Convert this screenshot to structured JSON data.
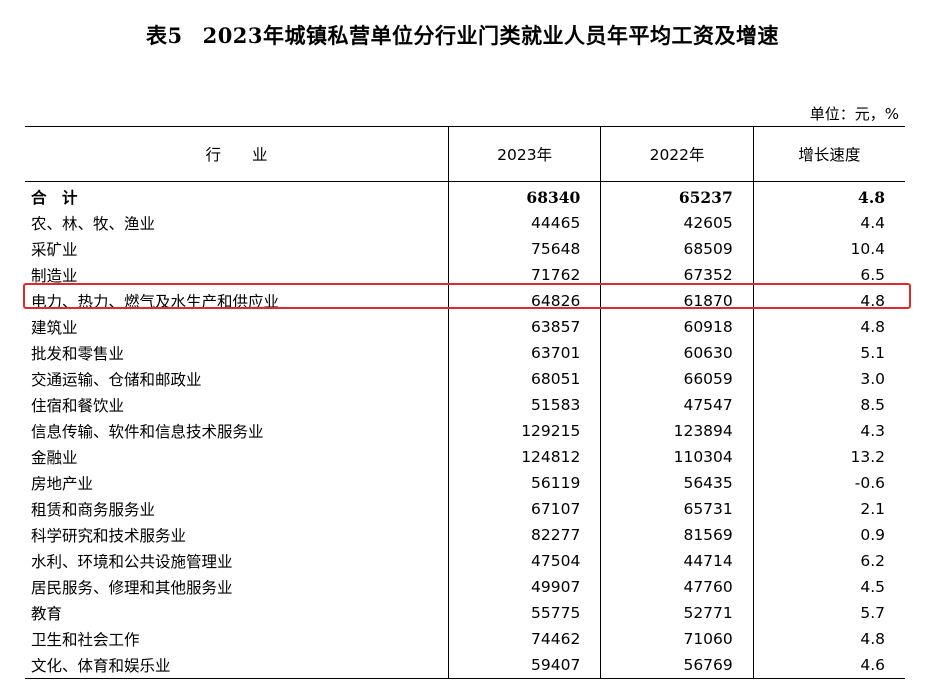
{
  "title": {
    "table_no": "表5",
    "text": "2023年城镇私营单位分行业门类就业人员年平均工资及增速"
  },
  "unit": "单位：元，%",
  "headers": {
    "industry": "行　　业",
    "y2023": "2023年",
    "y2022": "2022年",
    "growth": "增长速度"
  },
  "rows": [
    {
      "name": "合　计",
      "y2023": "68340",
      "y2022": "65237",
      "growth": "4.8"
    },
    {
      "name": "农、林、牧、渔业",
      "y2023": "44465",
      "y2022": "42605",
      "growth": "4.4"
    },
    {
      "name": "采矿业",
      "y2023": "75648",
      "y2022": "68509",
      "growth": "10.4"
    },
    {
      "name": "制造业",
      "y2023": "71762",
      "y2022": "67352",
      "growth": "6.5"
    },
    {
      "name": "电力、热力、燃气及水生产和供应业",
      "y2023": "64826",
      "y2022": "61870",
      "growth": "4.8"
    },
    {
      "name": "建筑业",
      "y2023": "63857",
      "y2022": "60918",
      "growth": "4.8"
    },
    {
      "name": "批发和零售业",
      "y2023": "63701",
      "y2022": "60630",
      "growth": "5.1"
    },
    {
      "name": "交通运输、仓储和邮政业",
      "y2023": "68051",
      "y2022": "66059",
      "growth": "3.0"
    },
    {
      "name": "住宿和餐饮业",
      "y2023": "51583",
      "y2022": "47547",
      "growth": "8.5"
    },
    {
      "name": "信息传输、软件和信息技术服务业",
      "y2023": "129215",
      "y2022": "123894",
      "growth": "4.3"
    },
    {
      "name": "金融业",
      "y2023": "124812",
      "y2022": "110304",
      "growth": "13.2"
    },
    {
      "name": "房地产业",
      "y2023": "56119",
      "y2022": "56435",
      "growth": "-0.6"
    },
    {
      "name": "租赁和商务服务业",
      "y2023": "67107",
      "y2022": "65731",
      "growth": "2.1"
    },
    {
      "name": "科学研究和技术服务业",
      "y2023": "82277",
      "y2022": "81569",
      "growth": "0.9"
    },
    {
      "name": "水利、环境和公共设施管理业",
      "y2023": "47504",
      "y2022": "44714",
      "growth": "6.2"
    },
    {
      "name": "居民服务、修理和其他服务业",
      "y2023": "49907",
      "y2022": "47760",
      "growth": "4.5"
    },
    {
      "name": "教育",
      "y2023": "55775",
      "y2022": "52771",
      "growth": "5.7"
    },
    {
      "name": "卫生和社会工作",
      "y2023": "74462",
      "y2022": "71060",
      "growth": "4.8"
    },
    {
      "name": "文化、体育和娱乐业",
      "y2023": "59407",
      "y2022": "56769",
      "growth": "4.6"
    }
  ],
  "highlight_color": "#e02a2a"
}
